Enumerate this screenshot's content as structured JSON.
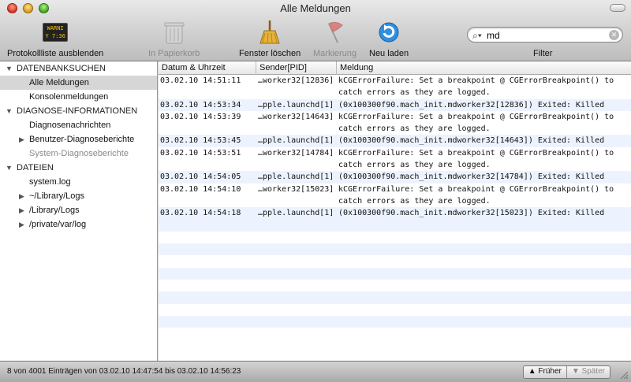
{
  "window": {
    "title": "Alle Meldungen"
  },
  "toolbar": {
    "hide_log_list": "Protokollliste ausblenden",
    "warn_icon_text_line1": "WARNI",
    "warn_icon_text_line2": "Y 7:36",
    "trash": "In Papierkorb",
    "clear_window": "Fenster löschen",
    "marker": "Markierung",
    "reload": "Neu laden",
    "filter": "Filter",
    "search_value": "md",
    "search_placeholder": ""
  },
  "sidebar": {
    "sections": [
      {
        "label": "DATENBANKSUCHEN"
      },
      {
        "label": "DIAGNOSE-INFORMATIONEN"
      },
      {
        "label": "DATEIEN"
      }
    ],
    "items": [
      {
        "label": "Alle Meldungen"
      },
      {
        "label": "Konsolenmeldungen"
      },
      {
        "label": "Diagnosenachrichten"
      },
      {
        "label": "Benutzer-Diagnoseberichte"
      },
      {
        "label": "System-Diagnoseberichte"
      },
      {
        "label": "system.log"
      },
      {
        "label": "~/Library/Logs"
      },
      {
        "label": "/Library/Logs"
      },
      {
        "label": "/private/var/log"
      }
    ]
  },
  "table": {
    "columns": [
      "Datum & Uhrzeit",
      "Sender[PID]",
      "Meldung"
    ],
    "rows": [
      {
        "date": "03.02.10 14:51:11",
        "sender": "…worker32[12836]",
        "msg1": "kCGErrorFailure: Set a breakpoint @ CGErrorBreakpoint() to",
        "msg2": "catch errors as they are logged."
      },
      {
        "date": "03.02.10 14:53:34",
        "sender": "…pple.launchd[1]",
        "msg1": "(0x100300f90.mach_init.mdworker32[12836]) Exited: Killed",
        "msg2": ""
      },
      {
        "date": "03.02.10 14:53:39",
        "sender": "…worker32[14643]",
        "msg1": "kCGErrorFailure: Set a breakpoint @ CGErrorBreakpoint() to",
        "msg2": "catch errors as they are logged."
      },
      {
        "date": "03.02.10 14:53:45",
        "sender": "…pple.launchd[1]",
        "msg1": "(0x100300f90.mach_init.mdworker32[14643]) Exited: Killed",
        "msg2": ""
      },
      {
        "date": "03.02.10 14:53:51",
        "sender": "…worker32[14784]",
        "msg1": "kCGErrorFailure: Set a breakpoint @ CGErrorBreakpoint() to",
        "msg2": "catch errors as they are logged."
      },
      {
        "date": "03.02.10 14:54:05",
        "sender": "…pple.launchd[1]",
        "msg1": "(0x100300f90.mach_init.mdworker32[14784]) Exited: Killed",
        "msg2": ""
      },
      {
        "date": "03.02.10 14:54:10",
        "sender": "…worker32[15023]",
        "msg1": "kCGErrorFailure: Set a breakpoint @ CGErrorBreakpoint() to",
        "msg2": "catch errors as they are logged."
      },
      {
        "date": "03.02.10 14:54:18",
        "sender": "…pple.launchd[1]",
        "msg1": "(0x100300f90.mach_init.mdworker32[15023]) Exited: Killed",
        "msg2": ""
      }
    ]
  },
  "status": {
    "text": "8 von 4001 Einträgen von 03.02.10 14:47:54 bis 03.02.10 14:56:23",
    "earlier": "Früher",
    "later": "Später"
  },
  "colors": {
    "row_alt": "#edf3fe",
    "selection": "#d6d6d6"
  }
}
